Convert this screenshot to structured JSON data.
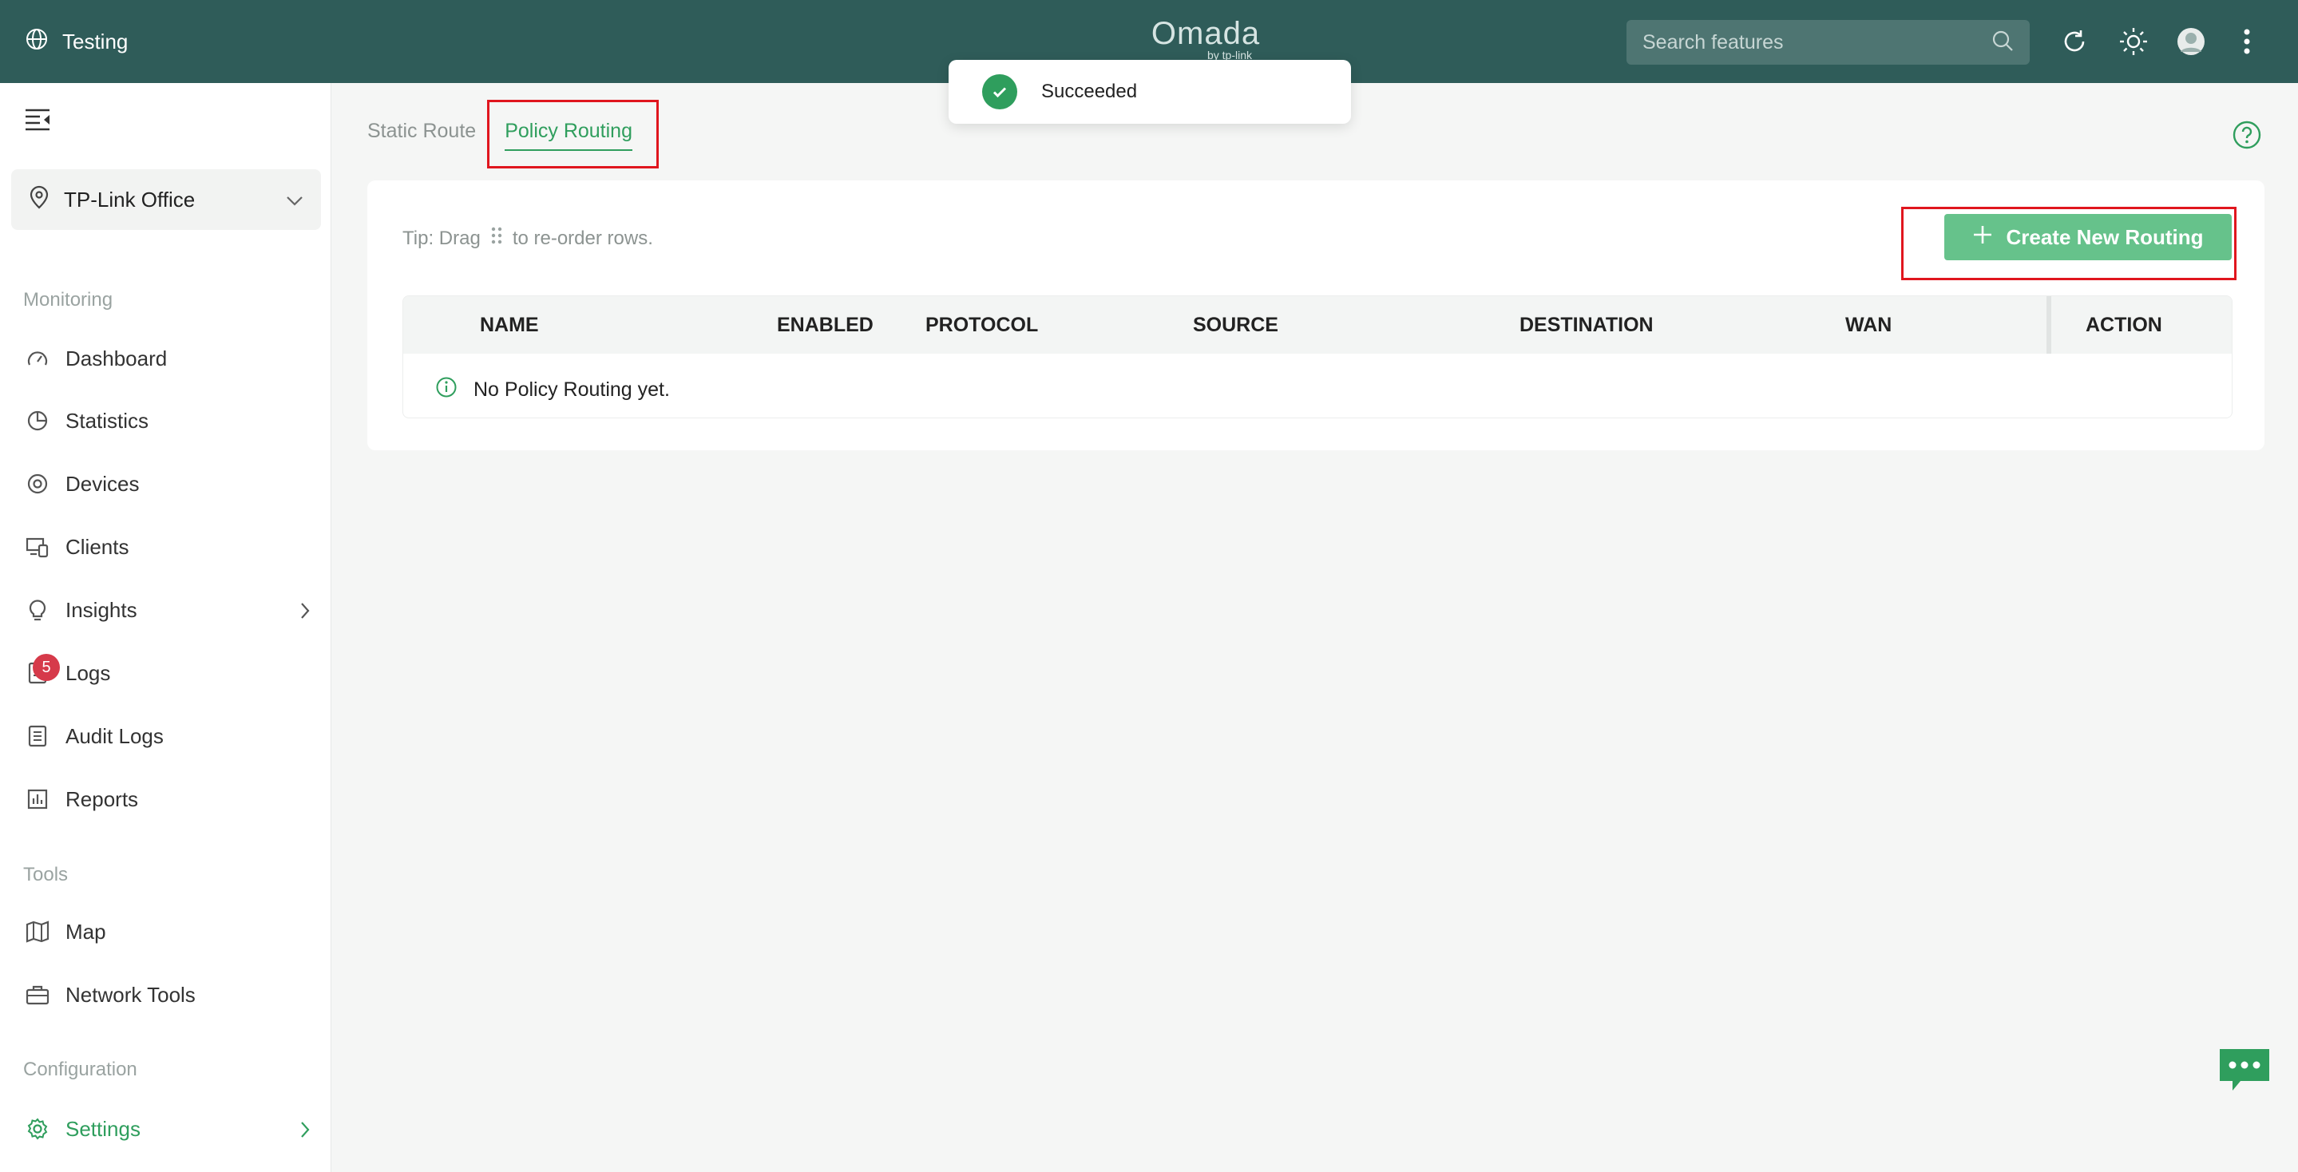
{
  "header": {
    "site_name": "Testing",
    "logo_text": "Omada",
    "logo_sub": "by tp-link",
    "search_placeholder": "Search features"
  },
  "toast": {
    "message": "Succeeded"
  },
  "sidebar": {
    "site_selector": "TP-Link Office",
    "sections": {
      "monitoring": "Monitoring",
      "tools": "Tools",
      "configuration": "Configuration"
    },
    "items": {
      "dashboard": "Dashboard",
      "statistics": "Statistics",
      "devices": "Devices",
      "clients": "Clients",
      "insights": "Insights",
      "logs": "Logs",
      "logs_badge": "5",
      "audit_logs": "Audit Logs",
      "reports": "Reports",
      "map": "Map",
      "network_tools": "Network Tools",
      "settings": "Settings"
    }
  },
  "tabs": {
    "static_route": "Static Route",
    "policy_routing": "Policy Routing"
  },
  "card": {
    "tip_prefix": "Tip: Drag",
    "tip_suffix": "to re-order rows.",
    "create_button": "Create New Routing",
    "columns": {
      "name": "NAME",
      "enabled": "ENABLED",
      "protocol": "PROTOCOL",
      "source": "SOURCE",
      "destination": "DESTINATION",
      "wan": "WAN",
      "action": "ACTION"
    },
    "empty_text": "No Policy Routing yet."
  },
  "colors": {
    "topbar": "#2f5c59",
    "accent": "#2f9e5d",
    "button": "#66c28b",
    "highlight": "#e0161e",
    "badge": "#d63a4a"
  }
}
